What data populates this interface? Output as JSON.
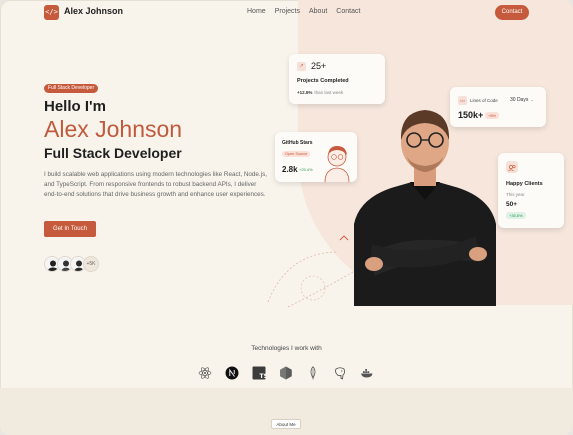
{
  "nav": {
    "logo_icon": "</>",
    "brand": "Alex Johnson",
    "links": [
      "Home",
      "Projects",
      "About",
      "Contact"
    ],
    "cta": "Contact"
  },
  "hero": {
    "badge": "Full Stack Developer",
    "greeting": "Hello I'm",
    "name": "Alex Johnson",
    "role": "Full Stack Developer",
    "description": "I build scalable web applications using modern technologies like React, Node.js, and TypeScript. From responsive frontends to robust backend APIs, I deliver end-to-end solutions that drive business growth and enhance user experiences.",
    "cta": "Get In Touch",
    "followers_more": "+5K"
  },
  "cards": {
    "projects": {
      "value": "25+",
      "label": "Projects Completed",
      "delta": "+12.5%",
      "delta_sub": "than last week"
    },
    "lines": {
      "label": "Lines of Code",
      "period": "30 Days",
      "value": "150k+",
      "delta": "+8%"
    },
    "github": {
      "label": "GitHub Stars",
      "tag": "Open Source",
      "value": "2.8k",
      "delta": "+25.4%"
    },
    "happy": {
      "label": "Happy Clients",
      "sub": "This year",
      "value": "50+",
      "delta": "+35.6%"
    }
  },
  "tech": {
    "title": "Technologies I work with",
    "icons": [
      "react-icon",
      "nextjs-icon",
      "typescript-icon",
      "nodejs-icon",
      "mongodb-icon",
      "postgresql-icon",
      "docker-icon"
    ]
  },
  "about": {
    "button": "About Me"
  },
  "colors": {
    "accent": "#c65a3c",
    "background": "#f8f4ec",
    "hero_tint": "#f6e6dc",
    "positive": "#2c9a55"
  }
}
